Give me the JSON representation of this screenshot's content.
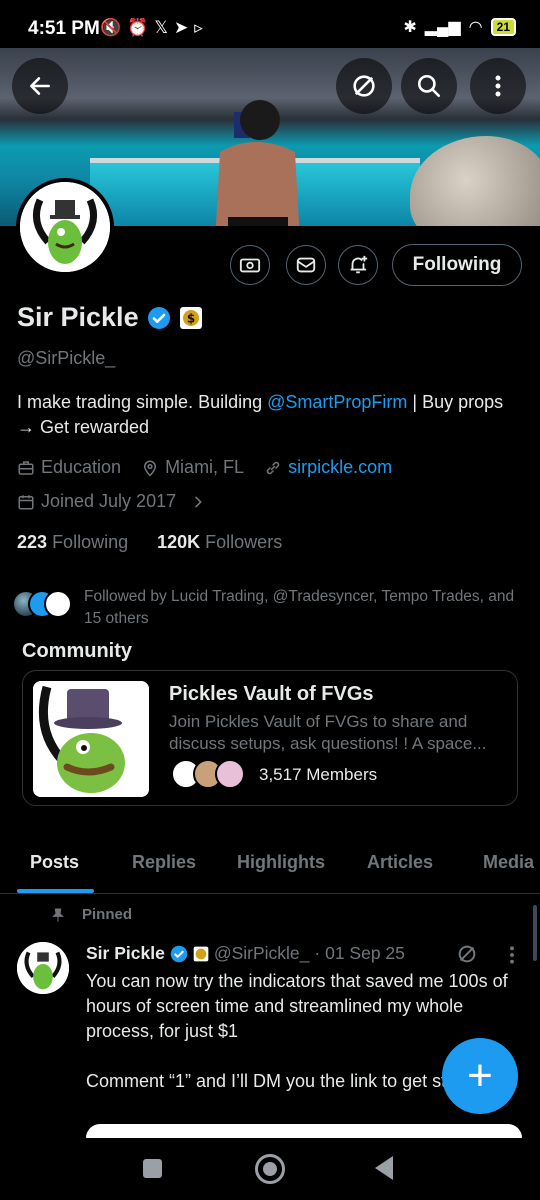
{
  "status_bar": {
    "time": "4:51 PM",
    "left_icons": "🔇⏰𝕏➤▹",
    "battery": "21"
  },
  "profile": {
    "name": "Sir Pickle",
    "handle": "@SirPickle_",
    "bio_prefix": "I make trading simple.  Building ",
    "bio_mention": "@SmartPropFirm",
    "bio_suffix": " | Buy props → Get rewarded",
    "category": "Education",
    "location": "Miami, FL",
    "website": "sirpickle.com",
    "joined": "Joined July 2017",
    "following_count": "223",
    "following_label": "Following",
    "followers_count": "120K",
    "followers_label": "Followers",
    "follow_button": "Following",
    "followed_by": "Followed by Lucid Trading, @Tradesyncer, Tempo Trades, and 15 others"
  },
  "community": {
    "section_title": "Community",
    "name": "Pickles Vault of FVGs",
    "description": "Join Pickles Vault of FVGs to share and discuss setups, ask questions! ! A space...",
    "members": "3,517 Members"
  },
  "tabs": [
    "Posts",
    "Replies",
    "Highlights",
    "Articles",
    "Media"
  ],
  "pinned_post": {
    "pinned_label": "Pinned",
    "author": "Sir Pickle",
    "handle": "@SirPickle_",
    "date": "· 01 Sep 25",
    "text_1": "You can now try the indicators that  saved me 100s of hours of screen time and streamlined my whole process, for just $1",
    "text_2": "Comment “1” and I’ll DM you the link to get started⤵️"
  },
  "fab_label": "+",
  "colors": {
    "accent": "#1d9bf0",
    "background": "#000000",
    "muted": "#71767b",
    "text": "#e7e9ea"
  }
}
